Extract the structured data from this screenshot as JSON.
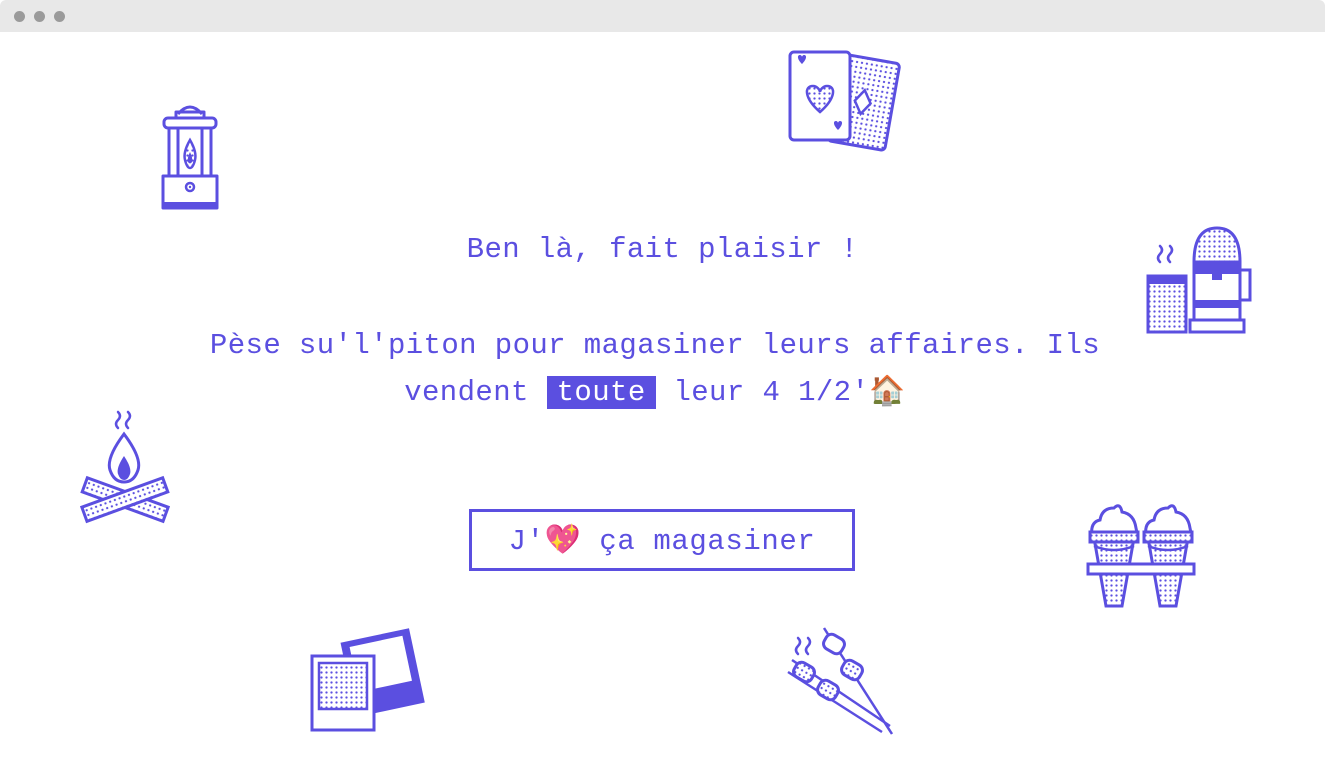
{
  "window": {
    "controls": [
      "close",
      "minimize",
      "maximize"
    ]
  },
  "content": {
    "headline": "Ben là, fait plaisir !",
    "body_before": "Pèse su'l'piton pour magasiner leurs affaires. Ils vendent ",
    "body_highlight": "toute",
    "body_after": " leur 4 1/2'🏠",
    "cta_label": "J'💖 ça magasiner"
  },
  "colors": {
    "accent": "#5b4fe0",
    "background": "#ffffff",
    "titlebar": "#e8e8e8"
  },
  "icons": [
    "lantern-icon",
    "playing-cards-icon",
    "coffee-maker-icon",
    "campfire-icon",
    "ice-cream-cones-icon",
    "polaroid-photos-icon",
    "marshmallow-skewers-icon"
  ]
}
